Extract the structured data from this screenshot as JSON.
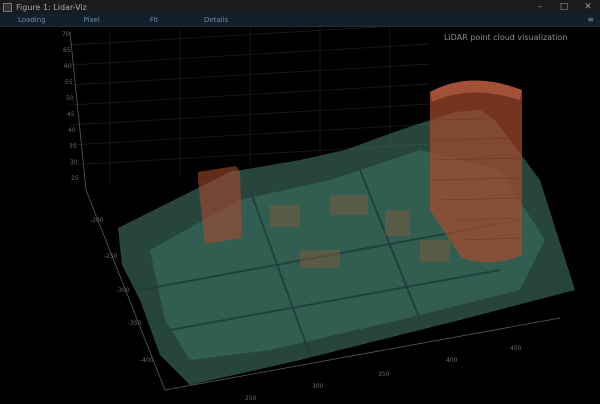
{
  "window": {
    "title": "Figure 1: Lidar-Viz",
    "controls": {
      "minimize": "–",
      "maximize": "□",
      "close": "✕"
    }
  },
  "menu": {
    "items": [
      "Loading",
      "Pixel",
      "Fit",
      "Details"
    ],
    "pin": "≡"
  },
  "plot": {
    "overlay_text": "LiDAR point cloud visualization",
    "z_ticks": [
      "70",
      "65",
      "60",
      "55",
      "50",
      "45",
      "40",
      "35",
      "30",
      "25"
    ],
    "y_ticks": [
      "-200",
      "-250",
      "-300",
      "-350",
      "-400"
    ],
    "x_ticks": [
      "250",
      "300",
      "350",
      "400",
      "450"
    ],
    "colors": {
      "ground": "#4f8a78",
      "building": "#a64a2e",
      "axis": "#5a5a5a",
      "text": "#8e8e8e"
    }
  }
}
